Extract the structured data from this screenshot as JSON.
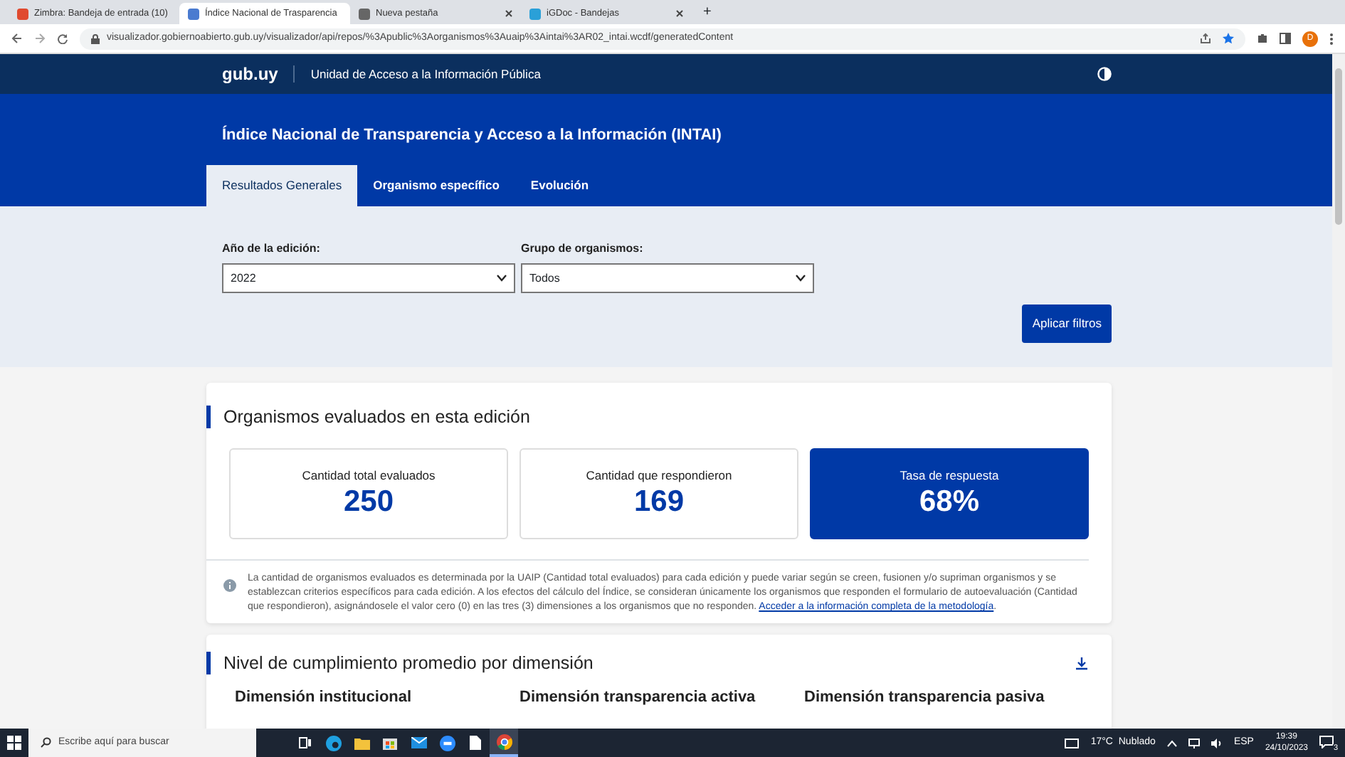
{
  "browser": {
    "tabs": [
      {
        "title": "Zimbra: Bandeja de entrada (10)",
        "selected": false
      },
      {
        "title": "Índice Nacional de Trasparencia",
        "selected": true
      },
      {
        "title": "Nueva pestaña",
        "selected": false
      },
      {
        "title": "iGDoc - Bandejas",
        "selected": false
      }
    ],
    "new_tab": "+",
    "url": "visualizador.gobiernoabierto.gub.uy/visualizador/api/repos/%3Apublic%3Aorganismos%3Auaip%3Aintai%3AR02_intai.wcdf/generatedContent",
    "profile": "D"
  },
  "site_header": {
    "logo": "gub.uy",
    "unit": "Unidad de Acceso a la Información Pública"
  },
  "banner": {
    "title": "Índice Nacional de Transparencia y Acceso a la Información (INTAI)",
    "tabs": [
      {
        "label": "Resultados Generales",
        "selected": true
      },
      {
        "label": "Organismo específico",
        "selected": false
      },
      {
        "label": "Evolución",
        "selected": false
      }
    ]
  },
  "filters": {
    "fields": [
      {
        "label": "Año de la edición:",
        "value": "2022"
      },
      {
        "label": "Grupo de organismos:",
        "value": "Todos"
      }
    ],
    "apply_button": "Aplicar filtros"
  },
  "evaluated": {
    "title": "Organismos evaluados en esta edición",
    "stats": [
      {
        "label": "Cantidad total evaluados",
        "value": "250",
        "highlighted": false
      },
      {
        "label": "Cantidad que respondieron",
        "value": "169",
        "highlighted": false
      },
      {
        "label": "Tasa de respuesta",
        "value": "68%",
        "highlighted": true
      }
    ],
    "note": "La cantidad de organismos evaluados es determinada por la UAIP (Cantidad total evaluados) para cada edición y puede variar según se creen, fusionen y/o supriman organismos y se establezcan criterios específicos para cada edición. A los efectos del cálculo del Índice, se consideran únicamente los organismos que responden el formulario de autoevaluación (Cantidad que respondieron), asignándosele el valor cero (0) en las tres (3) dimensiones a los organismos que no responden.",
    "note_link": "Acceder a la información completa de la metodología",
    "note_end": "."
  },
  "dimensions": {
    "title": "Nivel de cumplimiento promedio por dimensión",
    "columns": [
      "Dimensión institucional",
      "Dimensión transparencia activa",
      "Dimensión transparencia pasiva"
    ]
  },
  "taskbar": {
    "search_placeholder": "Escribe aquí para buscar",
    "weather": "17°C  Nublado",
    "language": "ESP",
    "time": "19:39",
    "date": "24/10/2023",
    "notifications": "3"
  }
}
